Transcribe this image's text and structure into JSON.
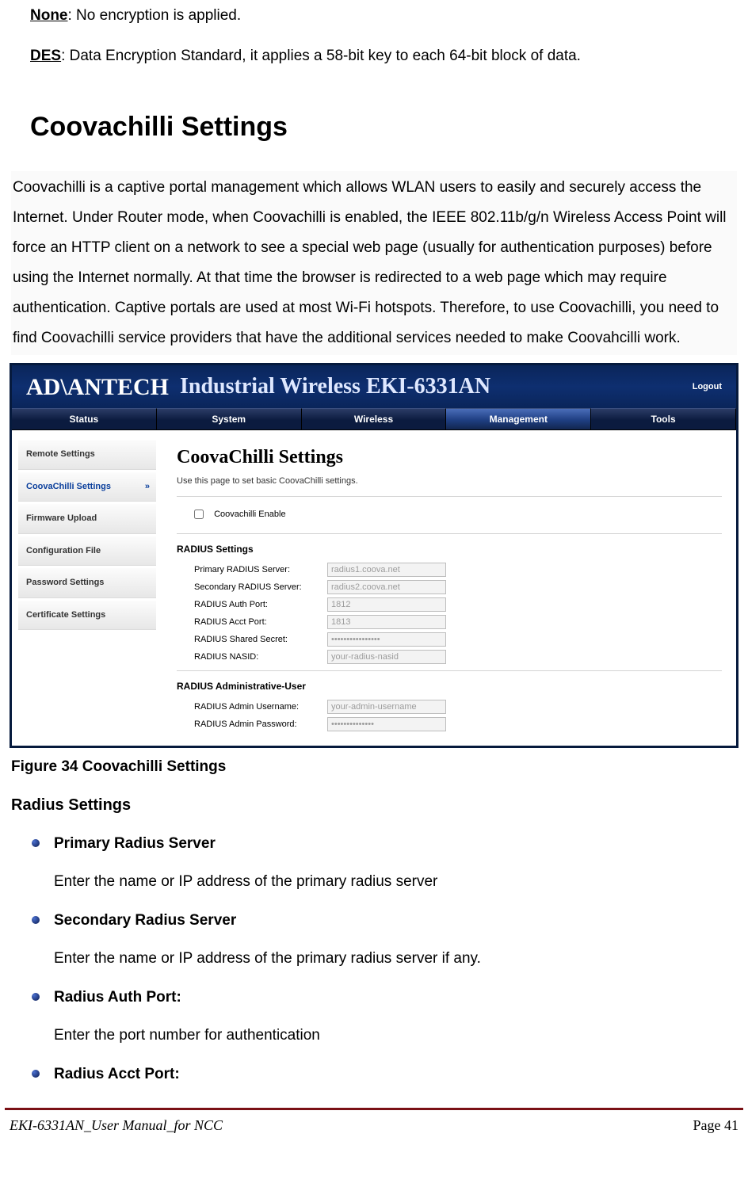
{
  "definitions": {
    "none": {
      "term": "None",
      "text": ": No encryption is applied."
    },
    "des": {
      "term": "DES",
      "text": ": Data Encryption Standard, it applies a 58-bit key to each 64-bit block of data."
    }
  },
  "section": {
    "title": "Coovachilli Settings",
    "paragraph": "Coovachilli is a captive portal management which allows WLAN users to easily and securely access the Internet. Under Router mode, when Coovachilli is enabled, the IEEE 802.11b/g/n Wireless Access Point will force an HTTP client on a network to see a special web page (usually for authentication purposes) before using the Internet normally.   At that time the browser is redirected to a web page which may require authentication.   Captive portals are used at most Wi-Fi hotspots.   Therefore, to use Coovachilli, you need to find Coovachilli service providers that have the additional services needed to make Coovahcilli work."
  },
  "screenshot": {
    "logo": "AD\\ANTECH",
    "product": "Industrial Wireless EKI-6331AN",
    "logout": "Logout",
    "tabs": [
      "Status",
      "System",
      "Wireless",
      "Management",
      "Tools"
    ],
    "activeTab": 3,
    "side": [
      "Remote Settings",
      "CoovaChilli Settings",
      "Firmware Upload",
      "Configuration File",
      "Password Settings",
      "Certificate Settings"
    ],
    "activeSide": 1,
    "main": {
      "title": "CoovaChilli Settings",
      "subtitle": "Use this page to set basic CoovaChilli settings.",
      "enableLabel": "Coovachilli Enable",
      "group1": "RADIUS Settings",
      "fields1": [
        {
          "label": "Primary RADIUS Server:",
          "value": "radius1.coova.net"
        },
        {
          "label": "Secondary RADIUS Server:",
          "value": "radius2.coova.net"
        },
        {
          "label": "RADIUS Auth Port:",
          "value": "1812"
        },
        {
          "label": "RADIUS Acct Port:",
          "value": "1813"
        },
        {
          "label": "RADIUS Shared Secret:",
          "value": "••••••••••••••••"
        },
        {
          "label": "RADIUS NASID:",
          "value": "your-radius-nasid"
        }
      ],
      "group2": "RADIUS Administrative-User",
      "fields2": [
        {
          "label": "RADIUS Admin Username:",
          "value": "your-admin-username"
        },
        {
          "label": "RADIUS Admin Password:",
          "value": "••••••••••••••"
        }
      ]
    }
  },
  "figCaption": "Figure 34 Coovachilli Settings",
  "radiusHeading": "Radius Settings",
  "bullets": [
    {
      "title": "Primary Radius Server",
      "desc": "Enter the name or IP address of the primary radius server"
    },
    {
      "title": "Secondary Radius Server",
      "desc": "Enter the name or IP address of the primary radius server if any."
    },
    {
      "title": "Radius Auth Port:",
      "desc": "Enter the port number for authentication"
    },
    {
      "title": "Radius Acct Port:",
      "desc": ""
    }
  ],
  "footer": {
    "left": "EKI-6331AN_User Manual_for NCC",
    "right": "Page 41"
  }
}
